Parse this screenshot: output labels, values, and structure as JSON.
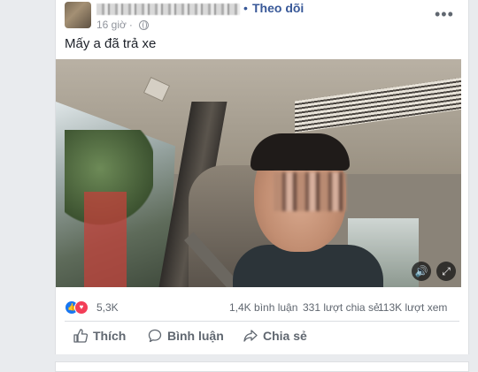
{
  "post": {
    "follow_dot": "•",
    "follow_label": "Theo dõi",
    "time": "16 giờ",
    "time_sep": "·",
    "more_label": "•••",
    "caption": "Mấy a đã trả xe"
  },
  "video": {
    "mute_icon": "🔊",
    "fullscreen_icon": "⤢"
  },
  "engagement": {
    "reaction_like_icon": "👍",
    "reaction_love_icon": "♥",
    "reaction_count": "5,3K",
    "comments": "1,4K bình luận",
    "shares": "331 lượt chia sẻ",
    "views": "113K lượt xem"
  },
  "actions": [
    {
      "label": "Thích",
      "icon": "thumbs-up-icon"
    },
    {
      "label": "Bình luận",
      "icon": "comment-icon"
    },
    {
      "label": "Chia sẻ",
      "icon": "share-icon"
    }
  ],
  "colors": {
    "link": "#385898",
    "like_blue": "#1877f2",
    "love_red": "#f33e58",
    "muted_text": "#606770"
  }
}
